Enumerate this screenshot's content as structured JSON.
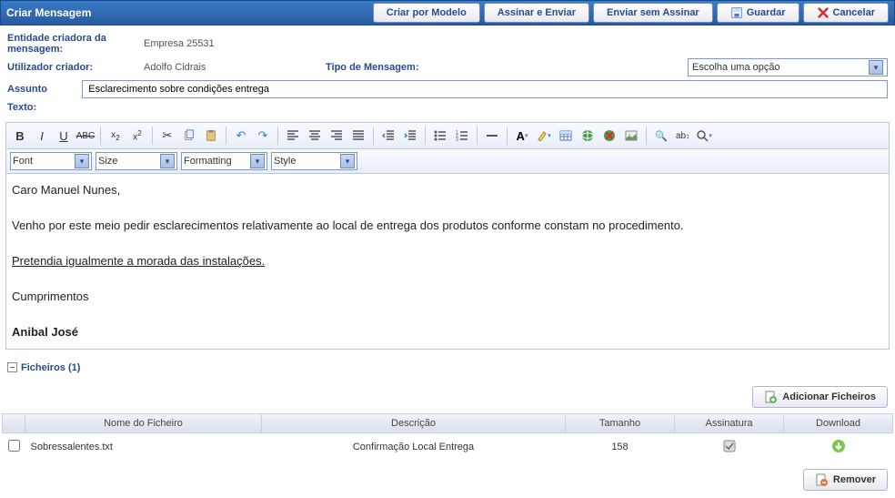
{
  "header": {
    "title": "Criar Mensagem",
    "buttons": {
      "criar_modelo": "Criar por Modelo",
      "assinar_enviar": "Assinar e Enviar",
      "enviar_sem_assinar": "Enviar sem Assinar",
      "guardar": "Guardar",
      "cancelar": "Cancelar"
    }
  },
  "form": {
    "entidade_label": "Entidade criadora da mensagem:",
    "entidade_value": "Empresa 25531",
    "utilizador_label": "Utilizador criador:",
    "utilizador_value": "Adolfo Cidrais",
    "tipo_label": "Tipo de Mensagem:",
    "tipo_value": "Escolha uma opção",
    "assunto_label": "Assunto",
    "assunto_value": "Esclarecimento sobre condições entrega",
    "texto_label": "Texto:"
  },
  "toolbar_selects": {
    "font": "Font",
    "size": "Size",
    "formatting": "Formatting",
    "style": "Style"
  },
  "editor": {
    "line1": "Caro Manuel Nunes,",
    "line2": "Venho por este meio pedir esclarecimentos relativamente ao local de entrega dos produtos conforme constam no procedimento.",
    "line3": "Pretendia igualmente a morada das instalações.",
    "line4": "Cumprimentos",
    "line5": "Anibal José"
  },
  "files": {
    "section_title": "Ficheiros (1)",
    "add_button": "Adicionar Ficheiros",
    "remove_button": "Remover",
    "columns": {
      "nome": "Nome do Ficheiro",
      "descricao": "Descrição",
      "tamanho": "Tamanho",
      "assinatura": "Assinatura",
      "download": "Download"
    },
    "rows": [
      {
        "nome": "Sobressalentes.txt",
        "descricao": "Confirmação Local Entrega",
        "tamanho": "158"
      }
    ]
  }
}
